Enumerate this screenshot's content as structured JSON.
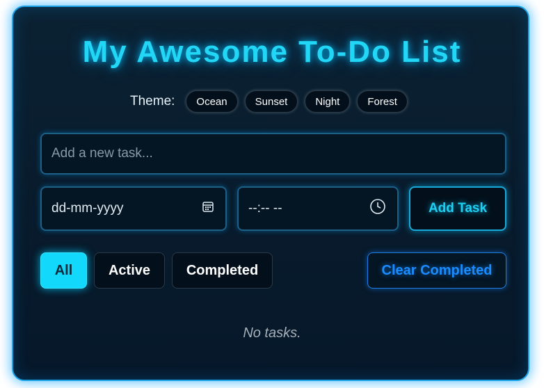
{
  "app": {
    "title": "My Awesome To-Do List"
  },
  "theme": {
    "label": "Theme:",
    "options": [
      "Ocean",
      "Sunset",
      "Night",
      "Forest"
    ]
  },
  "task_input": {
    "placeholder": "Add a new task..."
  },
  "date_input": {
    "placeholder": "dd-mm-yyyy",
    "icon": "calendar-icon"
  },
  "time_input": {
    "placeholder": "--:-- --",
    "icon": "clock-icon"
  },
  "add_button": {
    "label": "Add Task"
  },
  "filters": {
    "items": [
      "All",
      "Active",
      "Completed"
    ],
    "selected": "All"
  },
  "clear_button": {
    "label": "Clear Completed"
  },
  "task_list": {
    "empty_message": "No tasks."
  },
  "colors": {
    "accent": "#22d6f6",
    "clear_accent": "#1a8cff",
    "background": "#081b2c"
  }
}
